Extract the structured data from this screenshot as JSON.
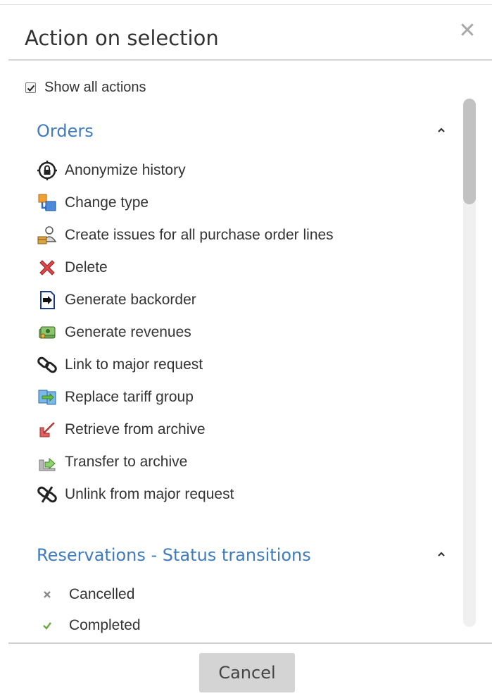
{
  "dialog": {
    "title": "Action on selection",
    "close_symbol": "✕",
    "close_icon": "close-icon"
  },
  "show_all": {
    "label": "Show all actions",
    "checked": true
  },
  "sections": [
    {
      "title": "Orders",
      "expanded": true,
      "actions": [
        {
          "label": "Anonymize history",
          "icon": "lock-target-icon"
        },
        {
          "label": "Change type",
          "icon": "change-type-icon"
        },
        {
          "label": "Create issues for all purchase order lines",
          "icon": "user-package-icon"
        },
        {
          "label": "Delete",
          "icon": "delete-x-icon"
        },
        {
          "label": "Generate backorder",
          "icon": "backorder-icon"
        },
        {
          "label": "Generate revenues",
          "icon": "money-icon"
        },
        {
          "label": "Link to major request",
          "icon": "chain-link-icon"
        },
        {
          "label": "Replace tariff group",
          "icon": "replace-icon"
        },
        {
          "label": "Retrieve from archive",
          "icon": "retrieve-arrow-icon"
        },
        {
          "label": "Transfer to archive",
          "icon": "transfer-arrow-icon"
        },
        {
          "label": "Unlink from major request",
          "icon": "broken-link-icon"
        }
      ]
    },
    {
      "title": "Reservations - Status transitions",
      "expanded": true,
      "actions": [
        {
          "label": "Cancelled",
          "icon": "cross-small-icon"
        },
        {
          "label": "Completed",
          "icon": "check-small-icon"
        }
      ]
    }
  ],
  "footer": {
    "cancel_label": "Cancel"
  },
  "colors": {
    "section_title": "#3f7cbf",
    "text": "#333333",
    "button_bg": "#d4d4d4"
  }
}
